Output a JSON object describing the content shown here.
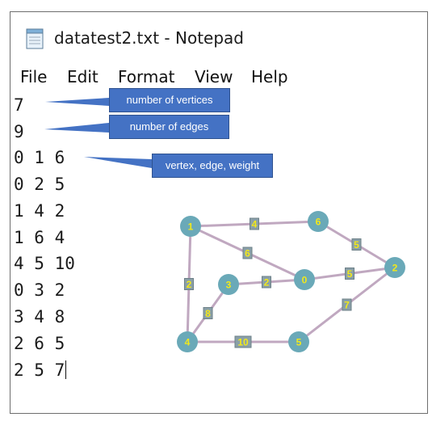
{
  "window": {
    "title": "datatest2.txt - Notepad",
    "icon": "notepad-icon"
  },
  "menu": [
    "File",
    "Edit",
    "Format",
    "View",
    "Help"
  ],
  "editor_lines": [
    "7",
    "9",
    "0 1 6",
    "0 2 5",
    "1 4 2",
    "1 6 4",
    "4 5 10",
    "0 3 2",
    "3 4 8",
    "2 6 5",
    "2 5 7"
  ],
  "callouts": {
    "vertices": "number of vertices",
    "edges": "number of edges",
    "format": "vertex, edge, weight"
  },
  "graph": {
    "node_color": "#6aa9b8",
    "edge_color": "#c0a8c0",
    "label_color": "#f2e81a",
    "nodes": [
      "0",
      "1",
      "2",
      "3",
      "4",
      "5",
      "6"
    ],
    "edges": [
      {
        "from": "0",
        "to": "1",
        "weight": "6"
      },
      {
        "from": "0",
        "to": "2",
        "weight": "5"
      },
      {
        "from": "1",
        "to": "4",
        "weight": "2"
      },
      {
        "from": "1",
        "to": "6",
        "weight": "4"
      },
      {
        "from": "4",
        "to": "5",
        "weight": "10"
      },
      {
        "from": "0",
        "to": "3",
        "weight": "2"
      },
      {
        "from": "3",
        "to": "4",
        "weight": "8"
      },
      {
        "from": "2",
        "to": "6",
        "weight": "5"
      },
      {
        "from": "2",
        "to": "5",
        "weight": "7"
      }
    ]
  }
}
